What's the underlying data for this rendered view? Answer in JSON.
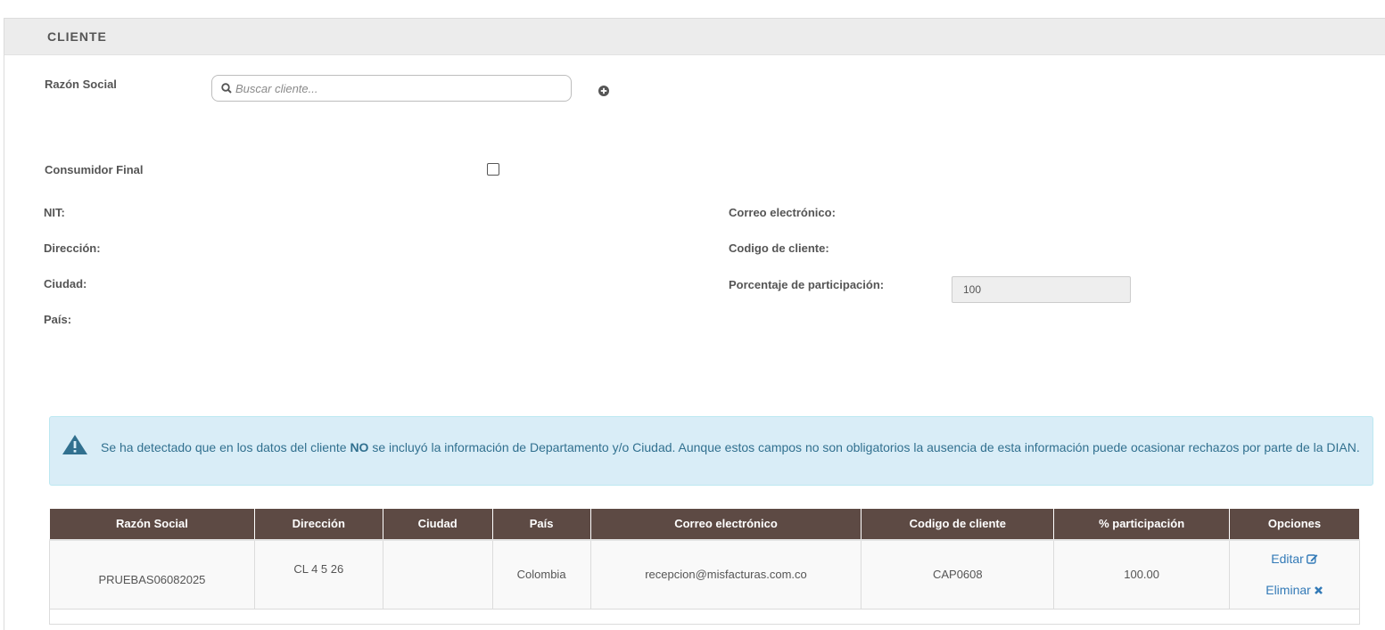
{
  "panel": {
    "title": "CLIENTE"
  },
  "form": {
    "razon_social_label": "Razón Social",
    "search_placeholder": "Buscar cliente...",
    "consumidor_final_label": "Consumidor Final",
    "nit_label": "NIT:",
    "direccion_label": "Dirección:",
    "ciudad_label": "Ciudad:",
    "pais_label": "País:",
    "correo_label": "Correo electrónico:",
    "codigo_label": "Codigo de cliente:",
    "porcentaje_label": "Porcentaje de participación:",
    "porcentaje_value": "100"
  },
  "alert": {
    "text_before": "Se ha detectado que en los datos del cliente ",
    "text_strong": "NO",
    "text_after": " se incluyó la información de Departamento y/o Ciudad. Aunque estos campos no son obligatorios la ausencia de esta información puede ocasionar rechazos por parte de la DIAN."
  },
  "table": {
    "headers": [
      "Razón Social",
      "Dirección",
      "Ciudad",
      "País",
      "Correo electrónico",
      "Codigo de cliente",
      "% participación",
      "Opciones"
    ],
    "rows": [
      {
        "razon_social": "PRUEBAS06082025",
        "direccion": "CL 4 5 26",
        "ciudad": "",
        "pais": "Colombia",
        "correo": "recepcion@misfacturas.com.co",
        "codigo": "CAP0608",
        "participacion": "100.00",
        "edit_label": "Editar",
        "delete_label": "Eliminar"
      }
    ]
  },
  "colors": {
    "header_bg": "#5d4a44",
    "alert_bg": "#d9edf7",
    "alert_text": "#31708f",
    "link": "#337ab7"
  }
}
